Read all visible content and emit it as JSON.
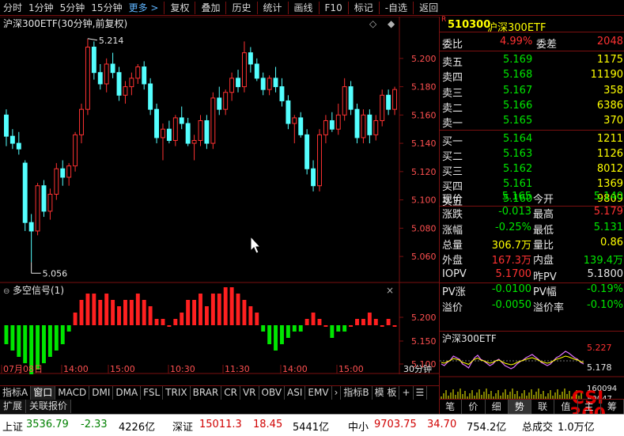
{
  "toolbar": {
    "items": [
      "分时",
      "1分钟",
      "5分钟",
      "15分钟",
      "更多 >",
      "复权",
      "叠加",
      "历史",
      "统计",
      "画线",
      "F10",
      "标记",
      "-自选",
      "返回"
    ]
  },
  "chart": {
    "title": "沪深300ETF(30分钟,前复权)",
    "max_label": "5.214",
    "min_label": "5.056",
    "y_ticks": [
      "5.200",
      "5.180",
      "5.160",
      "5.140",
      "5.120",
      "5.100",
      "5.080",
      "5.060"
    ],
    "indicator_title": "多空信号(1)",
    "ind_ticks": [
      "5.200",
      "5.150",
      "5.100"
    ],
    "x_labels": [
      "07月08日",
      "14:00",
      "15:00",
      "10:30",
      "11:30",
      "14:00",
      "15:00"
    ],
    "period_label": "30分钟",
    "colors": {
      "up": "#ff3232",
      "down": "#54ffff",
      "grid": "#7a1010",
      "bull": "#ff2020",
      "bear": "#00e600"
    }
  },
  "chart_data": {
    "type": "candlestick",
    "title": "沪深300ETF(30分钟,前复权)",
    "ylim": [
      5.05,
      5.215
    ],
    "candles": [
      {
        "o": 5.16,
        "h": 5.164,
        "l": 5.138,
        "c": 5.145
      },
      {
        "o": 5.145,
        "h": 5.15,
        "l": 5.136,
        "c": 5.14
      },
      {
        "o": 5.14,
        "h": 5.148,
        "l": 5.132,
        "c": 5.136
      },
      {
        "o": 5.126,
        "h": 5.128,
        "l": 5.078,
        "c": 5.084
      },
      {
        "o": 5.084,
        "h": 5.09,
        "l": 5.056,
        "c": 5.078
      },
      {
        "o": 5.078,
        "h": 5.112,
        "l": 5.075,
        "c": 5.11
      },
      {
        "o": 5.11,
        "h": 5.114,
        "l": 5.088,
        "c": 5.092
      },
      {
        "o": 5.092,
        "h": 5.108,
        "l": 5.086,
        "c": 5.104
      },
      {
        "o": 5.104,
        "h": 5.126,
        "l": 5.1,
        "c": 5.122
      },
      {
        "o": 5.122,
        "h": 5.128,
        "l": 5.11,
        "c": 5.116
      },
      {
        "o": 5.116,
        "h": 5.126,
        "l": 5.11,
        "c": 5.124
      },
      {
        "o": 5.124,
        "h": 5.148,
        "l": 5.12,
        "c": 5.146
      },
      {
        "o": 5.146,
        "h": 5.168,
        "l": 5.14,
        "c": 5.164
      },
      {
        "o": 5.164,
        "h": 5.214,
        "l": 5.16,
        "c": 5.208
      },
      {
        "o": 5.208,
        "h": 5.212,
        "l": 5.185,
        "c": 5.19
      },
      {
        "o": 5.19,
        "h": 5.196,
        "l": 5.178,
        "c": 5.182
      },
      {
        "o": 5.182,
        "h": 5.2,
        "l": 5.176,
        "c": 5.196
      },
      {
        "o": 5.196,
        "h": 5.204,
        "l": 5.186,
        "c": 5.19
      },
      {
        "o": 5.19,
        "h": 5.194,
        "l": 5.17,
        "c": 5.174
      },
      {
        "o": 5.174,
        "h": 5.184,
        "l": 5.168,
        "c": 5.18
      },
      {
        "o": 5.18,
        "h": 5.19,
        "l": 5.174,
        "c": 5.186
      },
      {
        "o": 5.186,
        "h": 5.196,
        "l": 5.182,
        "c": 5.194
      },
      {
        "o": 5.194,
        "h": 5.198,
        "l": 5.178,
        "c": 5.182
      },
      {
        "o": 5.182,
        "h": 5.186,
        "l": 5.16,
        "c": 5.164
      },
      {
        "o": 5.164,
        "h": 5.168,
        "l": 5.14,
        "c": 5.144
      },
      {
        "o": 5.144,
        "h": 5.154,
        "l": 5.128,
        "c": 5.15
      },
      {
        "o": 5.15,
        "h": 5.156,
        "l": 5.14,
        "c": 5.142
      },
      {
        "o": 5.142,
        "h": 5.16,
        "l": 5.138,
        "c": 5.158
      },
      {
        "o": 5.158,
        "h": 5.166,
        "l": 5.15,
        "c": 5.154
      },
      {
        "o": 5.154,
        "h": 5.158,
        "l": 5.138,
        "c": 5.14
      },
      {
        "o": 5.14,
        "h": 5.146,
        "l": 5.128,
        "c": 5.142
      },
      {
        "o": 5.142,
        "h": 5.16,
        "l": 5.138,
        "c": 5.156
      },
      {
        "o": 5.156,
        "h": 5.16,
        "l": 5.136,
        "c": 5.14
      },
      {
        "o": 5.14,
        "h": 5.176,
        "l": 5.136,
        "c": 5.172
      },
      {
        "o": 5.172,
        "h": 5.18,
        "l": 5.16,
        "c": 5.164
      },
      {
        "o": 5.164,
        "h": 5.178,
        "l": 5.16,
        "c": 5.176
      },
      {
        "o": 5.176,
        "h": 5.19,
        "l": 5.17,
        "c": 5.186
      },
      {
        "o": 5.186,
        "h": 5.192,
        "l": 5.176,
        "c": 5.18
      },
      {
        "o": 5.18,
        "h": 5.212,
        "l": 5.176,
        "c": 5.204
      },
      {
        "o": 5.204,
        "h": 5.208,
        "l": 5.19,
        "c": 5.196
      },
      {
        "o": 5.196,
        "h": 5.2,
        "l": 5.184,
        "c": 5.186
      },
      {
        "o": 5.186,
        "h": 5.19,
        "l": 5.174,
        "c": 5.178
      },
      {
        "o": 5.178,
        "h": 5.188,
        "l": 5.174,
        "c": 5.186
      },
      {
        "o": 5.186,
        "h": 5.194,
        "l": 5.176,
        "c": 5.18
      },
      {
        "o": 5.18,
        "h": 5.186,
        "l": 5.166,
        "c": 5.17
      },
      {
        "o": 5.17,
        "h": 5.174,
        "l": 5.15,
        "c": 5.154
      },
      {
        "o": 5.154,
        "h": 5.16,
        "l": 5.14,
        "c": 5.158
      },
      {
        "o": 5.158,
        "h": 5.162,
        "l": 5.144,
        "c": 5.146
      },
      {
        "o": 5.146,
        "h": 5.15,
        "l": 5.118,
        "c": 5.122
      },
      {
        "o": 5.122,
        "h": 5.128,
        "l": 5.106,
        "c": 5.11
      },
      {
        "o": 5.11,
        "h": 5.15,
        "l": 5.106,
        "c": 5.146
      },
      {
        "o": 5.146,
        "h": 5.16,
        "l": 5.14,
        "c": 5.156
      },
      {
        "o": 5.156,
        "h": 5.162,
        "l": 5.148,
        "c": 5.15
      },
      {
        "o": 5.15,
        "h": 5.168,
        "l": 5.146,
        "c": 5.16
      },
      {
        "o": 5.16,
        "h": 5.186,
        "l": 5.156,
        "c": 5.18
      },
      {
        "o": 5.18,
        "h": 5.184,
        "l": 5.16,
        "c": 5.164
      },
      {
        "o": 5.164,
        "h": 5.168,
        "l": 5.14,
        "c": 5.144
      },
      {
        "o": 5.144,
        "h": 5.164,
        "l": 5.14,
        "c": 5.16
      },
      {
        "o": 5.16,
        "h": 5.164,
        "l": 5.14,
        "c": 5.146
      },
      {
        "o": 5.146,
        "h": 5.16,
        "l": 5.142,
        "c": 5.156
      },
      {
        "o": 5.156,
        "h": 5.178,
        "l": 5.152,
        "c": 5.174
      },
      {
        "o": 5.174,
        "h": 5.178,
        "l": 5.16,
        "c": 5.164
      },
      {
        "o": 5.164,
        "h": 5.18,
        "l": 5.16,
        "c": 5.178
      }
    ],
    "signal": [
      -3,
      -4,
      -5,
      -6,
      -8,
      -7,
      -6,
      -5,
      -4,
      -3,
      -1,
      2,
      4,
      5,
      5,
      4,
      5,
      4,
      3,
      4,
      4,
      5,
      4,
      3,
      1,
      1,
      0,
      1,
      2,
      4,
      4,
      5,
      3,
      5,
      5,
      6,
      6,
      5,
      4,
      3,
      2,
      -1,
      -3,
      -4,
      -3,
      -2,
      -1,
      -1,
      1,
      2,
      1,
      0,
      -2,
      -1,
      -1,
      0,
      1,
      1,
      2,
      1,
      0,
      1,
      0
    ]
  },
  "quote": {
    "code": "510300",
    "name": "沪深300ETF",
    "webi_label": "委比",
    "webi_value": "4.99%",
    "weicha_label": "委差",
    "weicha_value": "2048",
    "asks": [
      {
        "label": "卖五",
        "price": "5.169",
        "vol": "1175"
      },
      {
        "label": "卖四",
        "price": "5.168",
        "vol": "11190"
      },
      {
        "label": "卖三",
        "price": "5.167",
        "vol": "358"
      },
      {
        "label": "卖二",
        "price": "5.166",
        "vol": "6386"
      },
      {
        "label": "卖一",
        "price": "5.165",
        "vol": "370"
      }
    ],
    "bids": [
      {
        "label": "买一",
        "price": "5.164",
        "vol": "1211"
      },
      {
        "label": "买二",
        "price": "5.163",
        "vol": "1126"
      },
      {
        "label": "买三",
        "price": "5.162",
        "vol": "8012"
      },
      {
        "label": "买四",
        "price": "5.161",
        "vol": "1369"
      },
      {
        "label": "买五",
        "price": "5.160",
        "vol": "9809"
      }
    ],
    "stats": [
      {
        "l1": "现价",
        "v1": "5.165",
        "c1": "green",
        "l2": "今开",
        "v2": "5.140",
        "c2": "green"
      },
      {
        "l1": "涨跌",
        "v1": "-0.013",
        "c1": "green",
        "l2": "最高",
        "v2": "5.179",
        "c2": "red"
      },
      {
        "l1": "涨幅",
        "v1": "-0.25%",
        "c1": "green",
        "l2": "最低",
        "v2": "5.131",
        "c2": "green"
      },
      {
        "l1": "总量",
        "v1": "306.7万",
        "c1": "yellow",
        "l2": "量比",
        "v2": "0.86",
        "c2": "yellow"
      },
      {
        "l1": "外盘",
        "v1": "167.3万",
        "c1": "red",
        "l2": "内盘",
        "v2": "139.4万",
        "c2": "green"
      }
    ],
    "iopv": [
      {
        "l1": "IOPV",
        "v1": "5.1700",
        "c1": "red",
        "l2": "昨PV",
        "v2": "5.1800",
        "c2": "white"
      },
      {
        "l1": "PV涨",
        "v1": "-0.0100",
        "c1": "green",
        "l2": "PV幅",
        "v2": "-0.19%",
        "c2": "green"
      },
      {
        "l1": "溢价",
        "v1": "-0.0050",
        "c1": "green",
        "l2": "溢价率",
        "v2": "-0.10%",
        "c2": "green"
      }
    ]
  },
  "mini": {
    "title": "沪深300ETF",
    "p_high": "5.227",
    "p_mid": "5.178",
    "vol_top": "160094",
    "vol_mid": "80047",
    "tabs": [
      "笔",
      "价",
      "细",
      "势",
      "联",
      "值",
      "主",
      "筹"
    ],
    "active_tab": 3,
    "price_path": [
      5.17,
      5.168,
      5.172,
      5.175,
      5.18,
      5.178,
      5.176,
      5.17,
      5.168,
      5.165,
      5.172,
      5.178,
      5.181,
      5.176,
      5.174,
      5.171,
      5.168,
      5.17,
      5.174,
      5.176,
      5.172,
      5.168,
      5.166,
      5.164,
      5.166,
      5.17,
      5.173,
      5.175,
      5.178,
      5.18,
      5.182,
      5.179,
      5.176,
      5.172,
      5.17,
      5.168,
      5.17,
      5.174,
      5.178,
      5.18,
      5.183,
      5.186,
      5.184,
      5.181,
      5.178,
      5.176,
      5.172,
      5.17
    ]
  },
  "logo": {
    "line1": "CSI",
    "line2": "300"
  },
  "bottom_tabs": [
    "指标A",
    "窗口",
    "MACD",
    "DMI",
    "DMA",
    "FSL",
    "TRIX",
    "BRAR",
    "CR",
    "VR",
    "OBV",
    "ASI",
    "EMV",
    "指标B",
    "模 板",
    "+",
    "☰"
  ],
  "ext_tabs": [
    "扩展",
    "关联报价"
  ],
  "status": {
    "sh_label": "上证",
    "sh_val": "3536.79",
    "sh_chg": "-2.33",
    "sh_amt": "4226亿",
    "sz_label": "深证",
    "sz_val": "15011.3",
    "sz_chg": "18.45",
    "sz_amt": "5441亿",
    "zx_label": "中小",
    "zx_val": "9703.75",
    "zx_chg": "34.70",
    "zx_amt": "754.2亿",
    "total_label": "总成交",
    "total_val": "1.0万亿"
  }
}
